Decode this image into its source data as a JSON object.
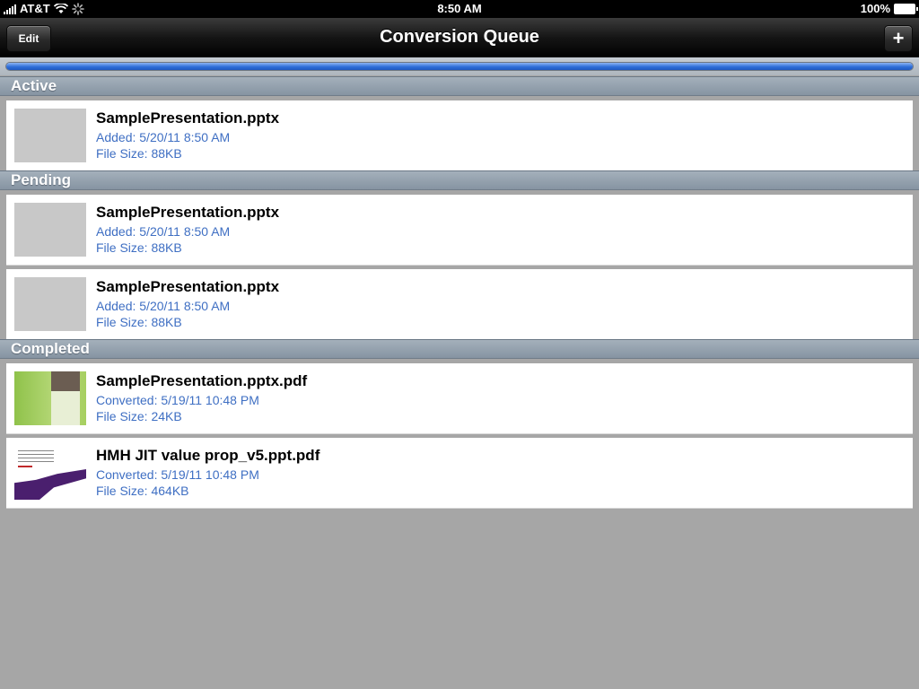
{
  "status_bar": {
    "carrier": "AT&T",
    "time": "8:50 AM",
    "battery": "100%"
  },
  "nav": {
    "title": "Conversion Queue",
    "edit_label": "Edit",
    "add_label": "+"
  },
  "progress": {
    "fraction": 1.0
  },
  "sections": [
    {
      "header": "Active",
      "items": [
        {
          "name": "SamplePresentation.pptx",
          "meta1": "Added: 5/20/11 8:50 AM",
          "meta2": "File Size: 88KB",
          "thumb": "blank"
        }
      ]
    },
    {
      "header": "Pending",
      "items": [
        {
          "name": "SamplePresentation.pptx",
          "meta1": "Added: 5/20/11 8:50 AM",
          "meta2": "File Size: 88KB",
          "thumb": "blank"
        },
        {
          "name": "SamplePresentation.pptx",
          "meta1": "Added: 5/20/11 8:50 AM",
          "meta2": "File Size: 88KB",
          "thumb": "blank"
        }
      ]
    },
    {
      "header": "Completed",
      "items": [
        {
          "name": "SamplePresentation.pptx.pdf",
          "meta1": "Converted: 5/19/11 10:48 PM",
          "meta2": "File Size: 24KB",
          "thumb": "green-slide"
        },
        {
          "name": "HMH JIT value prop_v5.ppt.pdf",
          "meta1": "Converted: 5/19/11 10:48 PM",
          "meta2": "File Size: 464KB",
          "thumb": "purple-slide"
        }
      ]
    }
  ],
  "colors": {
    "accent_blue": "#2f6fd8",
    "meta_text": "#3f6fc3",
    "background": "#a6a6a6"
  },
  "icons": [
    "signal-icon",
    "wifi-icon",
    "activity-spinner-icon",
    "battery-icon",
    "plus-icon"
  ]
}
